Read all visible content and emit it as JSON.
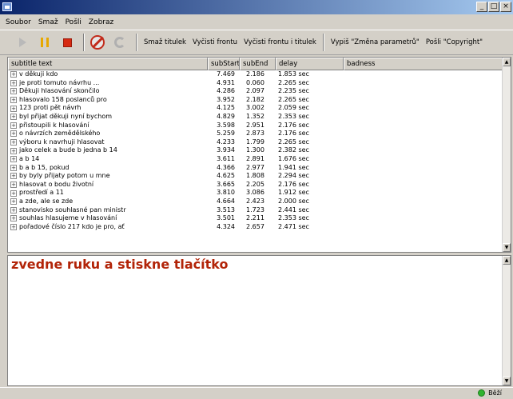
{
  "window": {
    "minimize": "_",
    "maximize": "□",
    "close": "×"
  },
  "menu": [
    "Soubor",
    "Smaž",
    "Pošli",
    "Zobraz"
  ],
  "toolbar": {
    "text_buttons": [
      "Smaž titulek",
      "Vyčisti frontu",
      "Vyčisti frontu i titulek",
      "Vypiš \"Změna parametrů\"",
      "Pošli \"Copyright\""
    ]
  },
  "table": {
    "columns": [
      "subtitle text",
      "subStart",
      "subEnd",
      "delay",
      "badness"
    ],
    "rows": [
      [
        "v děkuji kdo",
        "7.469",
        "2.186",
        "1.853 sec",
        ""
      ],
      [
        "je proti tomuto návrhu ...",
        "4.931",
        "0.060",
        "2.265 sec",
        ""
      ],
      [
        "Děkuji hlasování skončilo",
        "4.286",
        "2.097",
        "2.235 sec",
        ""
      ],
      [
        "hlasovalo 158 poslanců pro",
        "3.952",
        "2.182",
        "2.265 sec",
        ""
      ],
      [
        "123 proti pět návrh",
        "4.125",
        "3.002",
        "2.059 sec",
        ""
      ],
      [
        "byl přijat děkuji nyní bychom",
        "4.829",
        "1.352",
        "2.353 sec",
        ""
      ],
      [
        "přistoupili k hlasování",
        "3.598",
        "2.951",
        "2.176 sec",
        ""
      ],
      [
        "o návrzích zemědělského",
        "5.259",
        "2.873",
        "2.176 sec",
        ""
      ],
      [
        "výboru k navrhuji hlasovat",
        "4.233",
        "1.799",
        "2.265 sec",
        ""
      ],
      [
        "jako celek a bude b jedna b 14",
        "3.934",
        "1.300",
        "2.382 sec",
        ""
      ],
      [
        "a b 14",
        "3.611",
        "2.891",
        "1.676 sec",
        ""
      ],
      [
        "b a b 15, pokud",
        "4.366",
        "2.977",
        "1.941 sec",
        ""
      ],
      [
        "by byly přijaty potom u mne",
        "4.625",
        "1.808",
        "2.294 sec",
        ""
      ],
      [
        "hlasovat o bodu životní",
        "3.665",
        "2.205",
        "2.176 sec",
        ""
      ],
      [
        "prostředí a 11",
        "3.810",
        "3.086",
        "1.912 sec",
        ""
      ],
      [
        "a zde, ale se zde",
        "4.664",
        "2.423",
        "2.000 sec",
        ""
      ],
      [
        "stanovisko souhlasné pan ministr",
        "3.513",
        "1.723",
        "2.441 sec",
        ""
      ],
      [
        "souhlas hlasujeme v hlasování",
        "3.501",
        "2.211",
        "2.353 sec",
        ""
      ],
      [
        "pořadové číslo 217 kdo je pro, ať",
        "4.324",
        "2.657",
        "2.471 sec",
        ""
      ]
    ]
  },
  "editor": {
    "text": "zvedne ruku a stiskne tlačítko"
  },
  "status": {
    "label": "Běží",
    "color": "#2fb32f"
  }
}
